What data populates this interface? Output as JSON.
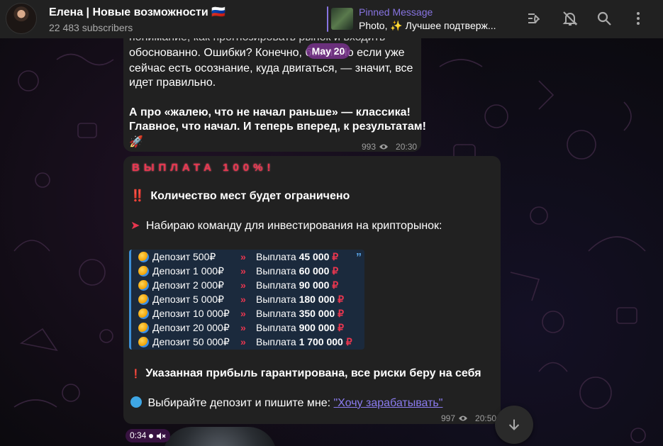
{
  "header": {
    "title": "Елена | Новые возможности 🇷🇺",
    "subscribers": "22 483 subscribers",
    "pinned_label": "Pinned Message",
    "pinned_text": "Photo, ✨  Лучшее подтверж..."
  },
  "date_chip": "May 20",
  "message1": {
    "lines": [
      "понимание, как прогнозировать рынок и входить",
      "обоснованно. Ошибки? Конечно, были! Но если уже",
      "сейчас есть осознание, куда двигаться, — значит, все",
      "идет правильно.",
      "А про «жалею, что не начал раньше» — классика!",
      "Главное, что начал. И теперь вперед, к результатам!",
      "🚀"
    ],
    "views": "993",
    "time": "20:30"
  },
  "message2": {
    "title": "ВЫПЛАТА 100%!",
    "line_limited_icon": "‼️",
    "line_limited": "Количество мест будет ограничено",
    "line_team_icon": "➤",
    "line_team": "Набираю команду для инвестирования на крипторынок:",
    "table": [
      {
        "deposit": "Депозит    500₽",
        "payout_label": "Выплата",
        "payout_value": "45 000"
      },
      {
        "deposit": "Депозит 1 000₽",
        "payout_label": "Выплата",
        "payout_value": "60 000"
      },
      {
        "deposit": "Депозит 2 000₽",
        "payout_label": "Выплата",
        "payout_value": "90 000"
      },
      {
        "deposit": "Депозит 5 000₽",
        "payout_label": "Выплата",
        "payout_value": "180 000"
      },
      {
        "deposit": "Депозит 10 000₽",
        "payout_label": "Выплата",
        "payout_value": "350 000"
      },
      {
        "deposit": "Депозит 20 000₽",
        "payout_label": "Выплата",
        "payout_value": "900 000"
      },
      {
        "deposit": "Депозит 50 000₽",
        "payout_label": "Выплата",
        "payout_value": "1 700 000"
      }
    ],
    "separator": "»",
    "currency": "₽",
    "guarantee_icon": "❗",
    "guarantee": "Указанная прибыль гарантирована, все риски беру на себя",
    "cta_text": "Выбирайте депозит и пишите мне: ",
    "cta_link": "\"Хочу зарабатывать\"",
    "views": "997",
    "time": "20:50"
  },
  "video": {
    "duration": "0:34"
  },
  "icons": {
    "pin": "pin-list-icon",
    "mute": "bell-off-icon",
    "search": "search-icon",
    "more": "more-vertical-icon",
    "scroll": "arrow-down-icon"
  },
  "colors": {
    "accent": "#8774e1",
    "payout_red": "#e8364f",
    "bubble_bg": "#212121",
    "header_bg": "#212121",
    "quote_bg": "#1b2a3d"
  }
}
